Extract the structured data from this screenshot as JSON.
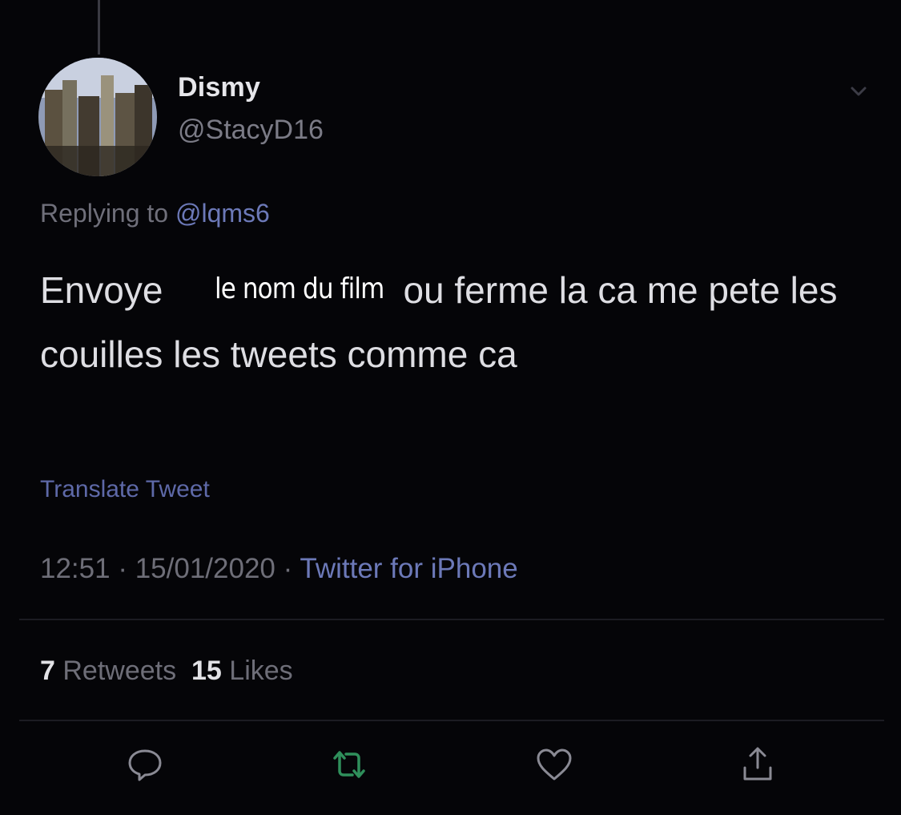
{
  "tweet": {
    "display_name": "Dismy",
    "handle": "@StacyD16",
    "replying_prefix": "Replying to",
    "replying_mention": "@lqms6",
    "text_before": "Envoye",
    "text_after": "ou ferme la ca me pete les couilles les tweets comme ca",
    "overlay_caption": "le nom du film",
    "translate_label": "Translate Tweet",
    "time": "12:51",
    "date": "15/01/2020",
    "source": "Twitter for iPhone",
    "separator": "·"
  },
  "stats": {
    "retweets_count": "7",
    "retweets_label": "Retweets",
    "likes_count": "15",
    "likes_label": "Likes"
  },
  "icons": {
    "menu": "chevron-down-icon",
    "reply": "reply-icon",
    "retweet": "retweet-icon",
    "like": "heart-icon",
    "share": "share-icon"
  },
  "colors": {
    "background": "#050508",
    "link": "#6c79b8",
    "retweet_green": "#2f8f5b",
    "muted": "#6e6e78"
  }
}
